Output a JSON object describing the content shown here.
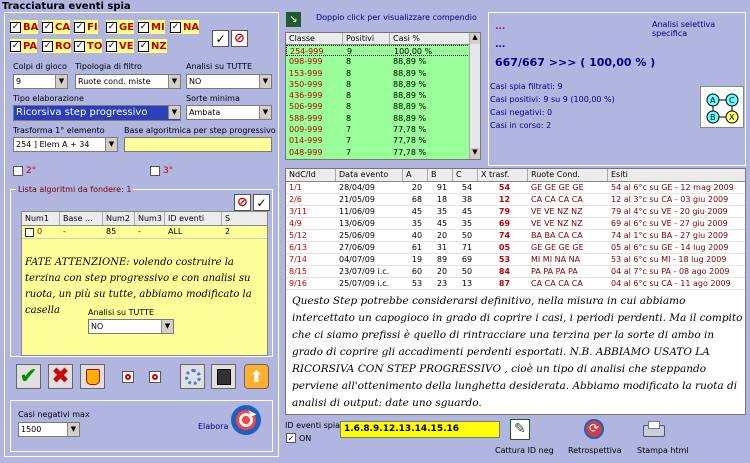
{
  "window": {
    "title": "Tracciatura eventi spia"
  },
  "wheels": [
    {
      "label": "BA",
      "checked": true
    },
    {
      "label": "CA",
      "checked": true
    },
    {
      "label": "FI",
      "checked": true
    },
    {
      "label": "GE",
      "checked": true
    },
    {
      "label": "MI",
      "checked": true
    },
    {
      "label": "NA",
      "checked": true
    },
    {
      "label": "PA",
      "checked": true
    },
    {
      "label": "RO",
      "checked": true
    },
    {
      "label": "TO",
      "checked": true
    },
    {
      "label": "VE",
      "checked": true
    },
    {
      "label": "NZ",
      "checked": true
    }
  ],
  "check_mark": "✓",
  "left": {
    "colpi_label": "Colpi di gioco",
    "colpi_value": "9",
    "tipologia_label": "Tipologia di filtro",
    "tipologia_value": "Ruote cond. miste",
    "analisi_label": "Analisi su TUTTE",
    "analisi_value": "NO",
    "tipo_elab_label": "Tipo elaborazione",
    "tipo_elab_value": "Ricorsiva step progressivo",
    "sorte_label": "Sorte minima",
    "sorte_value": "Ambata",
    "trasforma_label": "Trasforma 1° elemento",
    "trasforma_value": "254 ] Elem A + 34",
    "base_label": "Base algoritmica per step progressivo",
    "base_value": "",
    "opt2": "2°",
    "opt3": "3°",
    "lista_label": "Lista algoritmi da fondere: 1",
    "lista_cols": [
      "Num1",
      "Base ...",
      "Num2",
      "Num3",
      "ID eventi",
      "S"
    ],
    "lista_row": [
      "0",
      "-",
      "85",
      "-",
      "ALL",
      "2"
    ],
    "fate_text": "FATE ATTENZIONE: volendo costruire la terzina con step progressivo e con analisi su ruota, un più su tutte, abbiamo modificato la casella",
    "analisi2_label": "Analisi su TUTTE",
    "analisi2_value": "NO",
    "casi_neg_label": "Casi negativi max",
    "casi_neg_value": "1500",
    "elabora_label": "Elabora"
  },
  "compendio": {
    "hint": "Doppio click per visualizzare compendio",
    "cols": [
      "Classe",
      "Positivi",
      "Casi %"
    ],
    "rows": [
      [
        "254-999",
        "9",
        "100,00 %"
      ],
      [
        "098-999",
        "8",
        "88,89 %"
      ],
      [
        "153-999",
        "8",
        "88,89 %"
      ],
      [
        "350-999",
        "8",
        "88,89 %"
      ],
      [
        "436-999",
        "8",
        "88,89 %"
      ],
      [
        "506-999",
        "8",
        "88,89 %"
      ],
      [
        "588-999",
        "8",
        "88,89 %"
      ],
      [
        "009-999",
        "7",
        "77,78 %"
      ],
      [
        "014-999",
        "7",
        "77,78 %"
      ],
      [
        "048-999",
        "7",
        "77,78 %"
      ]
    ]
  },
  "analisi_spec": {
    "title": "Analisi selettiva specifica",
    "dots1": "...",
    "dots2": "...",
    "result": "667/667 >>> ( 100,00 % )",
    "stats": [
      "Casi spia filtrati: 9",
      "Casi positivi: 9 su 9 (100,00 %)",
      "Casi negativi: 0",
      "Casi in corso: 2"
    ],
    "diagram": [
      "A",
      "C",
      "B",
      "X"
    ]
  },
  "results": {
    "cols": [
      "NdC/Id",
      "Data evento",
      "A",
      "B",
      "C",
      "X trasf.",
      "Ruote Cond.",
      "Esiti"
    ],
    "rows": [
      [
        "1/1",
        "28/04/09",
        "20",
        "91",
        "54",
        "54",
        "GE GE GE GE",
        "54 al 6°c su GE - 12 mag 2009"
      ],
      [
        "2/6",
        "21/05/09",
        "68",
        "18",
        "38",
        "12",
        "CA CA CA CA",
        "12 al 3°c su CA - 03 giu 2009"
      ],
      [
        "3/11",
        "11/06/09",
        "45",
        "35",
        "45",
        "79",
        "VE VE NZ NZ",
        "79 al 4°c su VE - 20 giu 2009"
      ],
      [
        "4/9",
        "13/06/09",
        "35",
        "45",
        "35",
        "69",
        "VE VE NZ NZ",
        "69 al 6°c su VE - 27 giu 2009"
      ],
      [
        "5/12",
        "25/06/09",
        "40",
        "20",
        "50",
        "74",
        "BA BA CA CA",
        "74 al 1°c su BA - 27 giu 2009"
      ],
      [
        "6/13",
        "27/06/09",
        "61",
        "31",
        "71",
        "05",
        "GE GE GE GE",
        "05 al 6°c su GE - 14 lug 2009"
      ],
      [
        "7/14",
        "04/07/09",
        "19",
        "89",
        "69",
        "53",
        "MI MI NA NA",
        "53 al 6°c su MI - 18 lug 2009"
      ],
      [
        "8/15",
        "23/07/09 i.c.",
        "60",
        "20",
        "50",
        "84",
        "PA PA PA PA",
        "04 al 7°c su PA - 08 ago 2009"
      ],
      [
        "9/16",
        "25/07/09 i.c.",
        "53",
        "23",
        "13",
        "87",
        "CA CA CA CA",
        "04 al 6°c su CA - 11 ago 2009"
      ]
    ]
  },
  "note": "Questo Step potrebbe considerarsi definitivo, nella misura in cui abbiamo intercettato un capogioco in grado di coprire i casi, i periodi perdenti. Ma il compito che ci siamo prefissi è quello di rintracciare una terzina per la sorte di ambo in grado di coprire gli accadimenti perdenti esportati. N.B. ABBIAMO USATO LA RICORSIVA CON STEP PROGRESSIVO , cioè un tipo di analisi che steppando perviene all'ottenimento della lunghetta desiderata. Abbiamo modificato la ruota di analisi di output: date uno sguardo.",
  "bottom": {
    "id_label": "ID eventi spia",
    "id_value": "1.6.8.9.12.13.14.15.16",
    "on_label": "ON",
    "cattura_label": "Cattura ID neg",
    "retro_label": "Retrospettiva",
    "stampa_label": "Stampa html"
  },
  "colors": {
    "accent_red": "#c00000",
    "list_green": "#99ff99",
    "yellow": "#ffff88",
    "navy_text": "#000080"
  }
}
